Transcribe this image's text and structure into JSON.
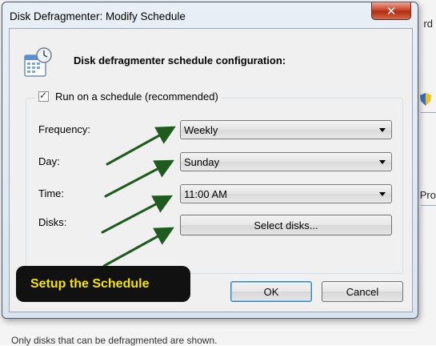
{
  "background": {
    "right_text_top": "rd",
    "right_text_mid": "Pro",
    "bottom_text": "Only disks that can be defragmented are shown."
  },
  "dialog": {
    "title": "Disk Defragmenter: Modify Schedule",
    "close_symbol": "✕",
    "header": "Disk defragmenter schedule configuration:",
    "header_icon": "calendar-clock-icon",
    "run_schedule": {
      "label": "Run on a schedule (recommended)",
      "checked": true
    },
    "fields": {
      "frequency_label": "Frequency:",
      "frequency_value": "Weekly",
      "day_label": "Day:",
      "day_value": "Sunday",
      "time_label": "Time:",
      "time_value": "11:00 AM",
      "disks_label": "Disks:",
      "select_disks_button": "Select disks..."
    },
    "ok_button": "OK",
    "cancel_button": "Cancel"
  },
  "annotation": {
    "callout_text": "Setup the Schedule",
    "arrow_color": "#1f5a1f",
    "callout_text_color": "#f5e400"
  }
}
